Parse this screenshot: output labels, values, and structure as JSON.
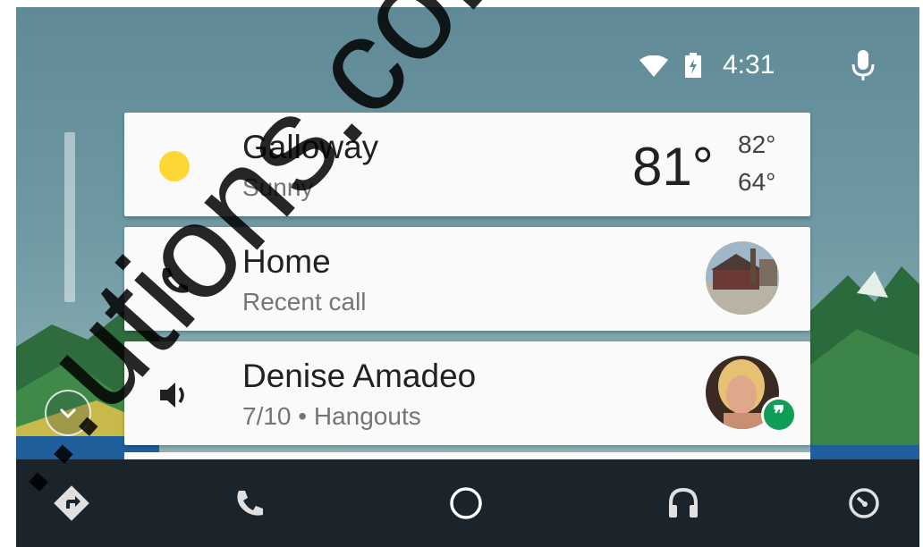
{
  "status": {
    "time": "4:31",
    "icons": [
      "wifi-icon",
      "battery-charging-icon",
      "mic-icon"
    ]
  },
  "cards": {
    "weather": {
      "location": "Galloway",
      "condition": "Sunny",
      "temp": "81°",
      "high": "82°",
      "low": "64°",
      "icon": "sun-icon"
    },
    "call": {
      "title": "Home",
      "subtitle": "Recent call",
      "icon": "phone-icon"
    },
    "media": {
      "title": "Denise Amadeo",
      "subtitle": "7/10 • Hangouts",
      "icon": "volume-icon",
      "badge_icon": "hangouts-icon",
      "badge_glyph": "❞"
    }
  },
  "nav": [
    "navigation-icon",
    "phone-icon",
    "home-icon",
    "headphones-icon",
    "exit-icon"
  ],
  "colors": {
    "nav_bg": "#1b232b",
    "card_bg": "#fafafa",
    "sun": "#fdd835",
    "hangouts": "#0f9d58"
  },
  "watermark": "...utions.co..."
}
